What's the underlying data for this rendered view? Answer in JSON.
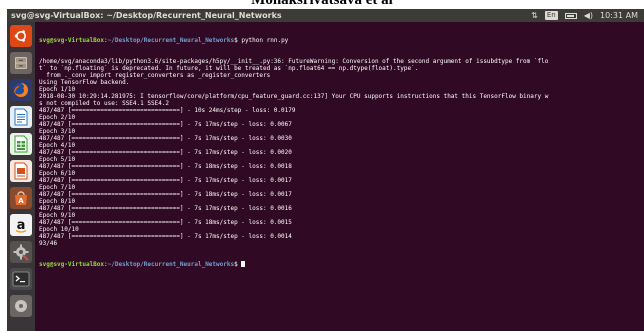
{
  "caption": "Monaksrivatsava et al",
  "window": {
    "title": "svg@svg-VirtualBox: ~/Desktop/Recurrent_Neural_Networks"
  },
  "indicators": {
    "keyboard": "En",
    "time": "10:31 AM"
  },
  "launcher": {
    "apps": [
      {
        "name": "Ubuntu Dash",
        "icon": "ubuntu-logo-icon",
        "color": "#dd4814"
      },
      {
        "name": "Files",
        "icon": "file-cabinet-icon",
        "color": "#9a8c7e"
      },
      {
        "name": "Firefox",
        "icon": "firefox-icon",
        "color": "#e66000"
      },
      {
        "name": "Writer",
        "icon": "writer-icon",
        "color": "#2a76c6"
      },
      {
        "name": "Calc",
        "icon": "calc-icon",
        "color": "#3f9c35"
      },
      {
        "name": "Impress",
        "icon": "impress-icon",
        "color": "#d0521b"
      },
      {
        "name": "Software Center",
        "icon": "software-center-icon",
        "color": "#e36b2b"
      },
      {
        "name": "Amazon",
        "icon": "amazon-icon",
        "color": "#ffffff"
      },
      {
        "name": "System Settings",
        "icon": "settings-gear-icon",
        "color": "#8a8a8a"
      },
      {
        "name": "Terminal",
        "icon": "terminal-icon",
        "color": "#2e2e2e"
      }
    ]
  },
  "terminal": {
    "prompt_user": "svg@svg-VirtualBox",
    "prompt_path": "~/Desktop/Recurrent_Neural_Networks",
    "command": " python rnn.py",
    "lines": [
      "/home/svg/anaconda3/lib/python3.6/site-packages/h5py/__init__.py:36: FutureWarning: Conversion of the second argument of issubdtype from `flo",
      "t` to `np.floating` is deprecated. In future, it will be treated as `np.float64 == np.dtype(float).type`.",
      "  from ._conv import register_converters as _register_converters",
      "Using TensorFlow backend.",
      "Epoch 1/10",
      "2018-08-30 10:29:14.281975: I tensorflow/core/platform/cpu_feature_guard.cc:137] Your CPU supports instructions that this TensorFlow binary w",
      "s not compiled to use: SSE4.1 SSE4.2",
      "487/487 [==============================] - 10s 24ms/step - loss: 0.0179",
      "Epoch 2/10",
      "487/487 [==============================] - 7s 17ms/step - loss: 0.0067",
      "Epoch 3/10",
      "487/487 [==============================] - 7s 17ms/step - loss: 0.0030",
      "Epoch 4/10",
      "487/487 [==============================] - 7s 17ms/step - loss: 0.0020",
      "Epoch 5/10",
      "487/487 [==============================] - 7s 18ms/step - loss: 0.0018",
      "Epoch 6/10",
      "487/487 [==============================] - 7s 17ms/step - loss: 0.0017",
      "Epoch 7/10",
      "487/487 [==============================] - 7s 18ms/step - loss: 0.0017",
      "Epoch 8/10",
      "487/487 [==============================] - 7s 17ms/step - loss: 0.0016",
      "Epoch 9/10",
      "487/487 [==============================] - 7s 18ms/step - loss: 0.0015",
      "Epoch 10/10",
      "487/487 [==============================] - 7s 17ms/step - loss: 0.0014",
      "93/46"
    ]
  }
}
